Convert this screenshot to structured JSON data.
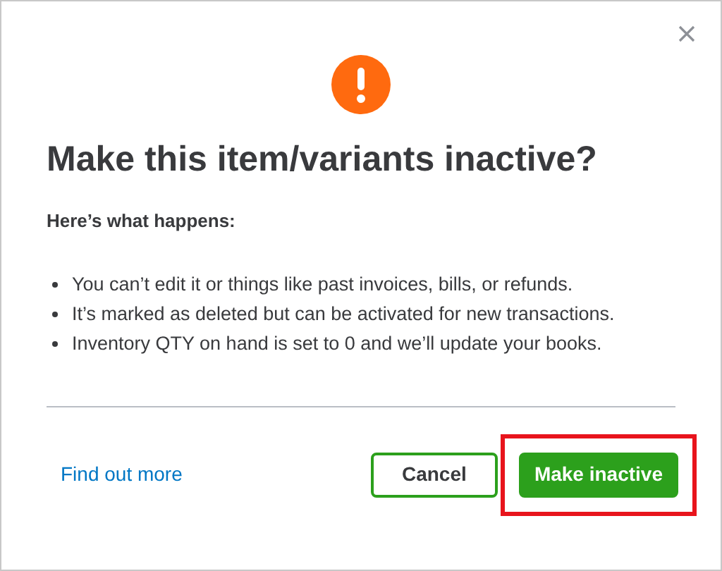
{
  "dialog": {
    "title": "Make this item/variants inactive?",
    "subtitle": "Here’s what happens:",
    "bullets": [
      "You can’t edit it or things like past invoices, bills, or refunds.",
      "It’s marked as deleted but can be activated for new transactions.",
      "Inventory QTY on hand is set to 0 and we’ll update your books."
    ],
    "link": "Find out more",
    "buttons": [
      {
        "label": "Cancel",
        "kind": "secondary",
        "highlighted": false
      },
      {
        "label": "Make inactive",
        "kind": "primary",
        "highlighted": true
      }
    ]
  }
}
